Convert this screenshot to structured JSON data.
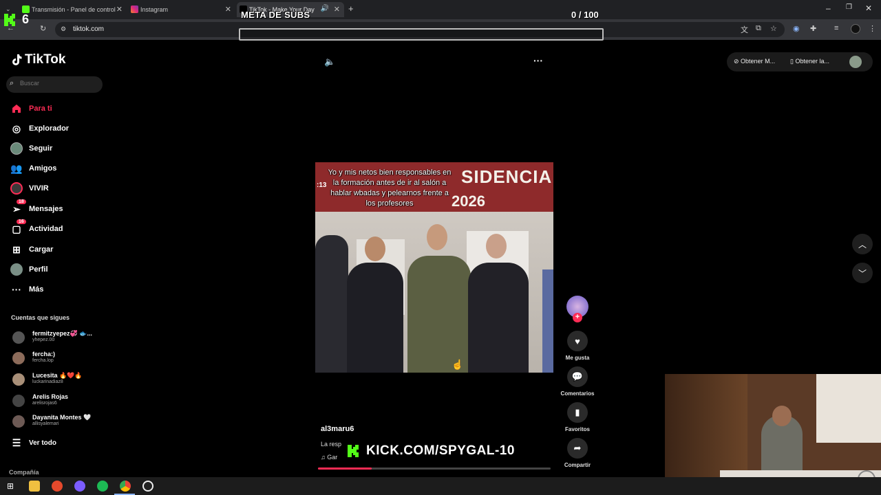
{
  "browser": {
    "tabs": [
      {
        "label": "Transmisión - Panel de control",
        "color": "#53fc18"
      },
      {
        "label": "Instagram",
        "color": "#e1306c"
      },
      {
        "label": "TikTok - Make Your Day",
        "color": "#ffffff"
      }
    ],
    "new_tab": "+",
    "url": "tiktok.com"
  },
  "stream_overlay": {
    "kick_badge_number": "6",
    "meta_title": "META DE SUBS",
    "meta_count": "0 / 100",
    "meta_progress": 0.0,
    "kick_url": "KICK.COM/SPYGAL-10"
  },
  "tiktok": {
    "logo_text": "TikTok",
    "search_placeholder": "Buscar",
    "nav": [
      {
        "label": "Para ti",
        "icon": "home-icon",
        "active": true
      },
      {
        "label": "Explorador",
        "icon": "compass-icon"
      },
      {
        "label": "Seguir",
        "icon": "following-avatar-icon"
      },
      {
        "label": "Amigos",
        "icon": "friends-icon"
      },
      {
        "label": "VIVIR",
        "icon": "live-icon"
      },
      {
        "label": "Mensajes",
        "icon": "messages-icon",
        "badge": "18"
      },
      {
        "label": "Actividad",
        "icon": "activity-icon",
        "badge": "16"
      },
      {
        "label": "Cargar",
        "icon": "upload-icon"
      },
      {
        "label": "Perfil",
        "icon": "profile-icon"
      },
      {
        "label": "Más",
        "icon": "more-icon"
      }
    ],
    "following_title": "Cuentas que sigues",
    "following": [
      {
        "name": "fermitzyepez💞 🐟...",
        "handle": "yhepez.00"
      },
      {
        "name": "fercha:)",
        "handle": "fercha.lop"
      },
      {
        "name": "Lucesita 🔥❤️🔥",
        "handle": "luckarinadiaz8"
      },
      {
        "name": "Arelis Rojas",
        "handle": "arelisrojas6"
      },
      {
        "name": "Dayanita Montes 🤍",
        "handle": "allisyalemari"
      }
    ],
    "see_all": "Ver todo",
    "company": "Compañía",
    "top_buttons": [
      "Obtener M...",
      "Obtener la..."
    ],
    "video": {
      "caption": "Yo y mis netos bien responsables en la formación antes de ir al salón a hablar wbadas y pelearnos frente a los profesores",
      "banner_text": "SIDENCIAL",
      "banner_year": "2026",
      "clock": ":13",
      "author": "al3maru6",
      "description": "La resp",
      "music": "Gar",
      "progress": 0.23
    },
    "actions": [
      {
        "label": "Me gusta",
        "icon": "heart-icon"
      },
      {
        "label": "Comentarios",
        "icon": "comment-icon"
      },
      {
        "label": "Favoritos",
        "icon": "bookmark-icon"
      },
      {
        "label": "Compartir",
        "icon": "share-icon"
      }
    ]
  }
}
